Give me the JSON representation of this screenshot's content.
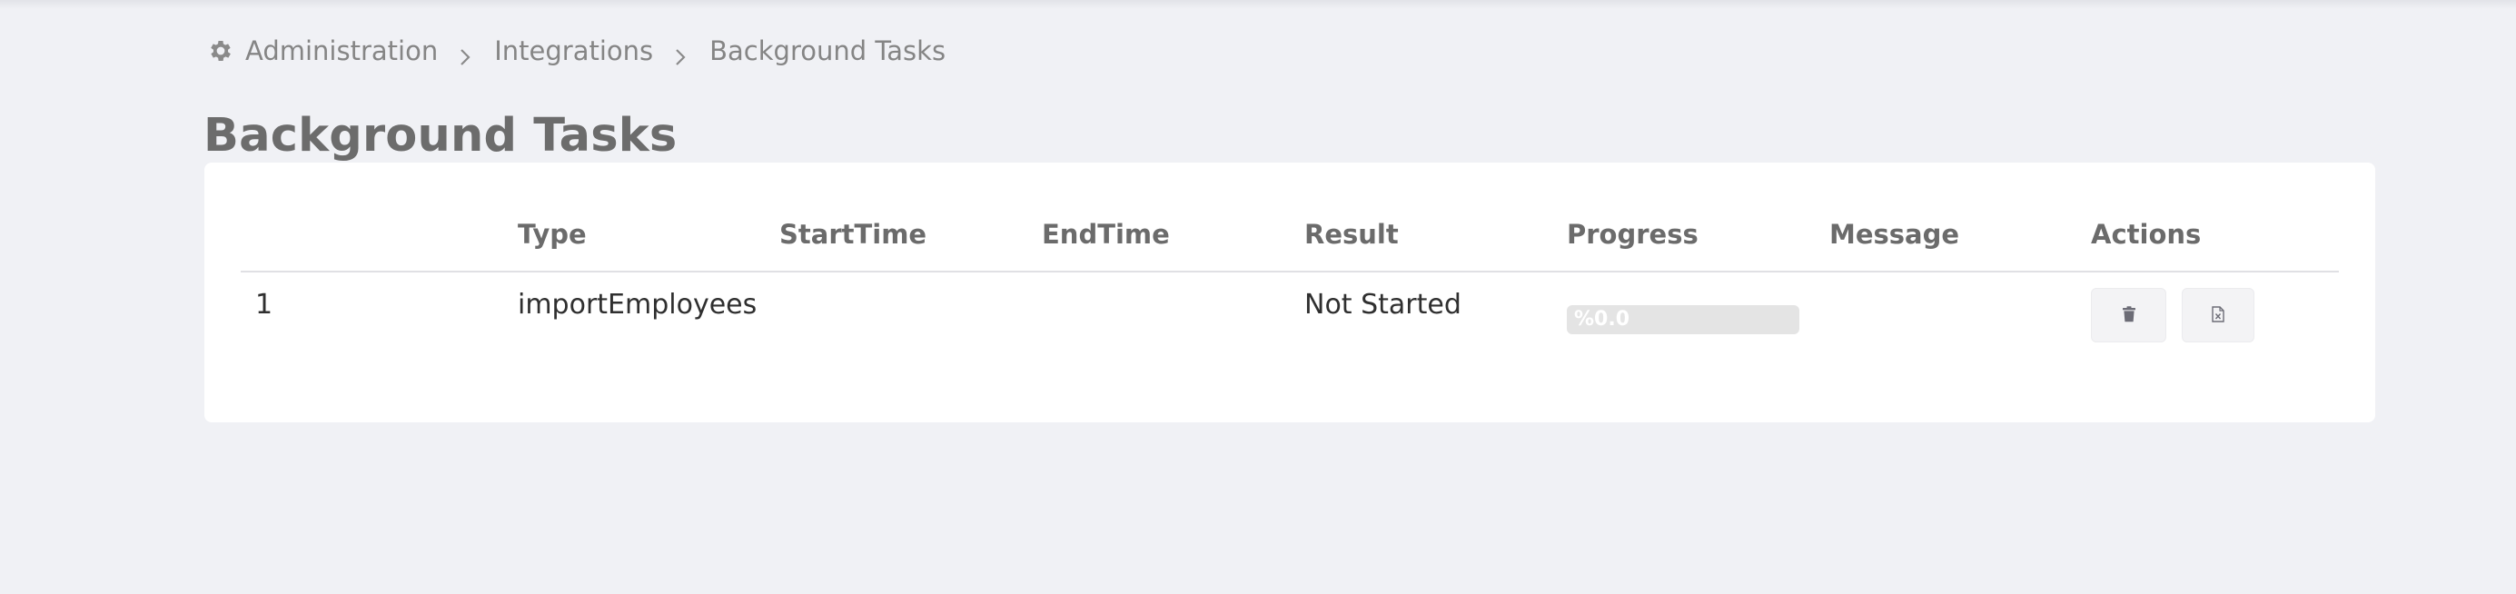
{
  "breadcrumb": {
    "icon": "gear-icon",
    "items": [
      "Administration",
      "Integrations",
      "Background Tasks"
    ]
  },
  "page_title": "Background Tasks",
  "table": {
    "columns": [
      "",
      "Type",
      "StartTime",
      "EndTime",
      "Result",
      "Progress",
      "Message",
      "Actions"
    ],
    "rows": [
      {
        "id": "1",
        "type": "importEmployees",
        "start_time": "",
        "end_time": "",
        "result": "Not Started",
        "progress_label": "%0.0",
        "progress_value": 0.0,
        "message": "",
        "actions": [
          "trash-icon",
          "file-excel-icon"
        ]
      }
    ]
  },
  "colors": {
    "background": "#f0f1f5",
    "card": "#ffffff",
    "progress_track": "#e4e4e4",
    "button_bg": "#f3f3f5"
  }
}
